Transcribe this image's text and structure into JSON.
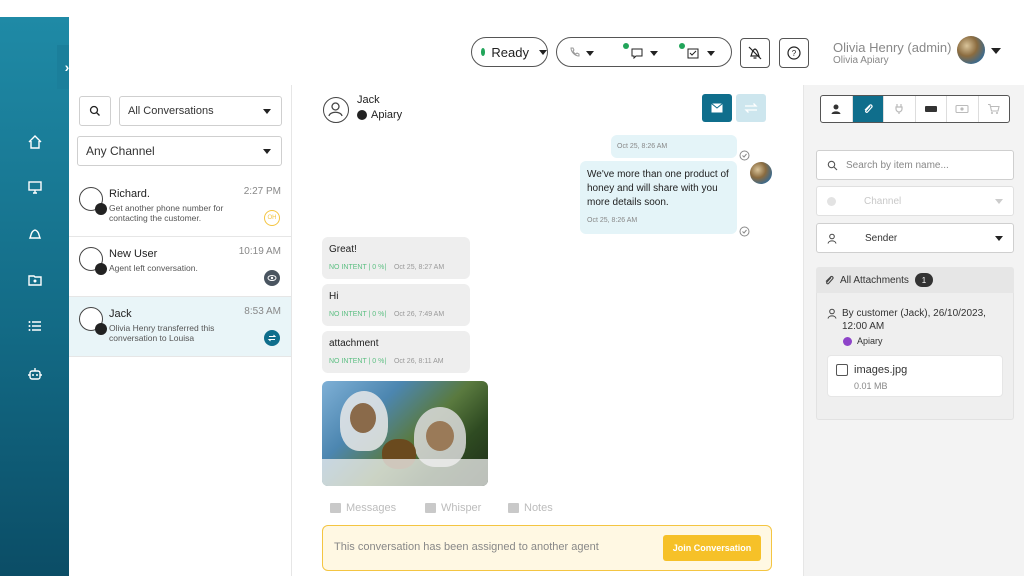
{
  "topbar": {
    "status_label": "Ready",
    "user_name": "Olivia Henry (admin)",
    "user_org": "Olivia Apiary",
    "status_color": "#22a55a"
  },
  "sidebar": {
    "items": [
      {
        "icon": "home-icon"
      },
      {
        "icon": "monitor-icon"
      },
      {
        "icon": "bell-icon"
      },
      {
        "icon": "folder-icon"
      },
      {
        "icon": "list-icon"
      },
      {
        "icon": "bot-icon"
      }
    ]
  },
  "conversations": {
    "filter_label": "All Conversations",
    "channel_label": "Any Channel",
    "items": [
      {
        "name": "Richard.",
        "time": "2:27 PM",
        "message": "Get another phone number for contacting the customer.",
        "badge": "OH"
      },
      {
        "name": "New User",
        "time": "10:19 AM",
        "message": "Agent left conversation.",
        "badge": ""
      },
      {
        "name": "Jack",
        "time": "8:53 AM",
        "message": "Olivia Henry transferred this conversation to Louisa",
        "badge": ""
      }
    ]
  },
  "chat": {
    "contact_name": "Jack",
    "contact_channel": "Apiary",
    "outgoing": [
      {
        "time": "Oct 25, 8:26 AM"
      },
      {
        "text": "We've more than one product of honey and will share with you more details soon.",
        "time": "Oct 25, 8:26 AM"
      }
    ],
    "incoming": [
      {
        "text": "Great!",
        "intent": "NO INTENT | 0 %|",
        "time": "Oct 25, 8:27 AM"
      },
      {
        "text": "Hi",
        "intent": "NO INTENT | 0 %|",
        "time": "Oct 26, 7:49 AM"
      },
      {
        "text": "attachment",
        "intent": "NO INTENT | 0 %|",
        "time": "Oct 26, 8:11 AM"
      }
    ],
    "tabs": [
      "Messages",
      "Whisper",
      "Notes"
    ],
    "assigned_notice": "This conversation has been assigned to another agent",
    "join_label": "Join Conversation"
  },
  "rpanel": {
    "search_placeholder": "Search by item name...",
    "channel_label": "Channel",
    "sender_label": "Sender",
    "attachments_label": "All Attachments",
    "attachments_count": "1",
    "attachment_by": "By customer (Jack), 26/10/2023, 12:00 AM",
    "attachment_channel": "Apiary",
    "file_name": "images.jpg",
    "file_size": "0.01 MB"
  }
}
